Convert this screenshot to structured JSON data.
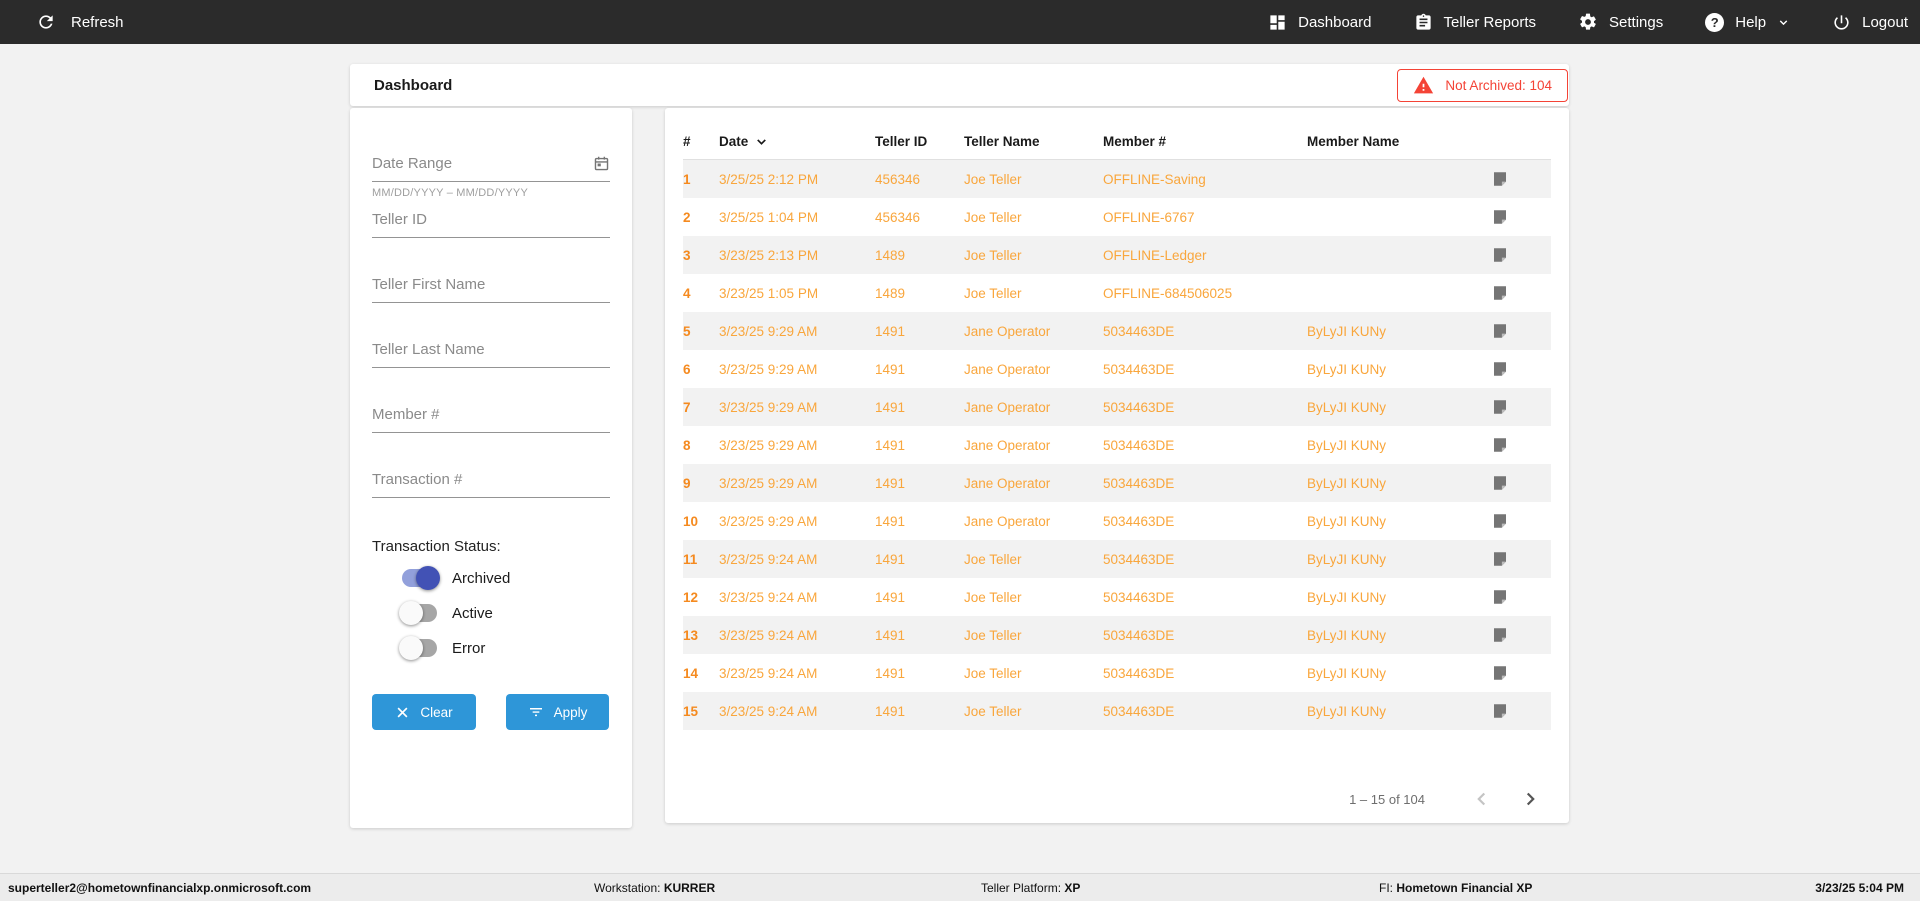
{
  "topbar": {
    "refresh": "Refresh",
    "nav_dashboard": "Dashboard",
    "nav_teller_reports": "Teller Reports",
    "nav_settings": "Settings",
    "nav_help": "Help",
    "nav_logout": "Logout"
  },
  "header": {
    "title": "Dashboard",
    "not_archived_badge": "Not Archived: 104"
  },
  "filters": {
    "date_range_label": "Date Range",
    "date_range_helper": "MM/DD/YYYY – MM/DD/YYYY",
    "teller_id_label": "Teller ID",
    "teller_first_name_label": "Teller First Name",
    "teller_last_name_label": "Teller Last Name",
    "member_number_label": "Member #",
    "transaction_number_label": "Transaction #",
    "status_label": "Transaction Status:",
    "toggles": [
      {
        "label": "Archived",
        "on": true
      },
      {
        "label": "Active",
        "on": false
      },
      {
        "label": "Error",
        "on": false
      }
    ],
    "clear_button": "Clear",
    "apply_button": "Apply"
  },
  "table": {
    "columns": [
      "#",
      "Date",
      "Teller ID",
      "Teller Name",
      "Member #",
      "Member Name"
    ],
    "sorted_column": "Date",
    "sort_direction": "desc",
    "rows": [
      {
        "num": "1",
        "date": "3/25/25 2:12 PM",
        "teller_id": "456346",
        "teller_name": "Joe Teller",
        "member_number": "OFFLINE-Saving",
        "member_name": ""
      },
      {
        "num": "2",
        "date": "3/25/25 1:04 PM",
        "teller_id": "456346",
        "teller_name": "Joe Teller",
        "member_number": "OFFLINE-6767",
        "member_name": ""
      },
      {
        "num": "3",
        "date": "3/23/25 2:13 PM",
        "teller_id": "1489",
        "teller_name": "Joe Teller",
        "member_number": "OFFLINE-Ledger",
        "member_name": ""
      },
      {
        "num": "4",
        "date": "3/23/25 1:05 PM",
        "teller_id": "1489",
        "teller_name": "Joe Teller",
        "member_number": "OFFLINE-684506025",
        "member_name": ""
      },
      {
        "num": "5",
        "date": "3/23/25 9:29 AM",
        "teller_id": "1491",
        "teller_name": "Jane Operator",
        "member_number": "5034463DE",
        "member_name": "ByLyJI KUNy"
      },
      {
        "num": "6",
        "date": "3/23/25 9:29 AM",
        "teller_id": "1491",
        "teller_name": "Jane Operator",
        "member_number": "5034463DE",
        "member_name": "ByLyJI KUNy"
      },
      {
        "num": "7",
        "date": "3/23/25 9:29 AM",
        "teller_id": "1491",
        "teller_name": "Jane Operator",
        "member_number": "5034463DE",
        "member_name": "ByLyJI KUNy"
      },
      {
        "num": "8",
        "date": "3/23/25 9:29 AM",
        "teller_id": "1491",
        "teller_name": "Jane Operator",
        "member_number": "5034463DE",
        "member_name": "ByLyJI KUNy"
      },
      {
        "num": "9",
        "date": "3/23/25 9:29 AM",
        "teller_id": "1491",
        "teller_name": "Jane Operator",
        "member_number": "5034463DE",
        "member_name": "ByLyJI KUNy"
      },
      {
        "num": "10",
        "date": "3/23/25 9:29 AM",
        "teller_id": "1491",
        "teller_name": "Jane Operator",
        "member_number": "5034463DE",
        "member_name": "ByLyJI KUNy"
      },
      {
        "num": "11",
        "date": "3/23/25 9:24 AM",
        "teller_id": "1491",
        "teller_name": "Joe Teller",
        "member_number": "5034463DE",
        "member_name": "ByLyJI KUNy"
      },
      {
        "num": "12",
        "date": "3/23/25 9:24 AM",
        "teller_id": "1491",
        "teller_name": "Joe Teller",
        "member_number": "5034463DE",
        "member_name": "ByLyJI KUNy"
      },
      {
        "num": "13",
        "date": "3/23/25 9:24 AM",
        "teller_id": "1491",
        "teller_name": "Joe Teller",
        "member_number": "5034463DE",
        "member_name": "ByLyJI KUNy"
      },
      {
        "num": "14",
        "date": "3/23/25 9:24 AM",
        "teller_id": "1491",
        "teller_name": "Joe Teller",
        "member_number": "5034463DE",
        "member_name": "ByLyJI KUNy"
      },
      {
        "num": "15",
        "date": "3/23/25 9:24 AM",
        "teller_id": "1491",
        "teller_name": "Joe Teller",
        "member_number": "5034463DE",
        "member_name": "ByLyJI KUNy"
      }
    ],
    "pagination": {
      "range": "1 – 15 of 104"
    }
  },
  "footer": {
    "user": "superteller2@hometownfinancialxp.onmicrosoft.com",
    "workstation_label": "Workstation: ",
    "workstation": "KURRER",
    "platform_label": "Teller Platform: ",
    "platform": "XP",
    "fi_label": "FI: ",
    "fi": "Hometown Financial XP",
    "datetime": "3/23/25 5:04 PM"
  },
  "colors": {
    "topbar_bg": "#2b2b2b",
    "page_bg": "#f2f2f2",
    "cell_orange": "#f9a63c",
    "row_number_orange": "#f58a1f",
    "alert_red": "#f44336",
    "button_blue": "#2e96d8",
    "toggle_on_thumb": "#4252b5",
    "toggle_on_track": "#92a0db"
  }
}
